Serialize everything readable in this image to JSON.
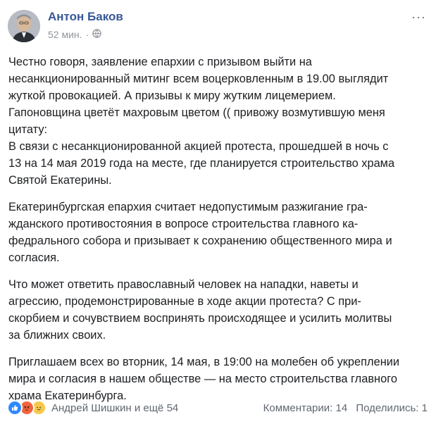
{
  "post": {
    "author": "Антон Баков",
    "time": "52 мин.",
    "dot": "·",
    "more": "···",
    "paragraphs": [
      [
        "Честно говоря, заявление епархии с призывом выйти на",
        "несанкционированный митинг всем воцерковленным в 19.00 выглядит",
        "жуткой провокацией. А призывы к миру жутким лицемерием.",
        "Гапоновщина цветёт махровым цветом (( привожу возмутившую меня",
        "цитату:",
        "В связи с несанкционированной акцией протеста, прошедшей в ночь с",
        "13 на 14 мая 2019 года на месте, где планируется строительство храма",
        "Святой Екатерины."
      ],
      [
        "Екатеринбургская епархия считает недопустимым разжигание гра-",
        "жданского противостояния в вопросе строительства главного ка-",
        "федрального собора и призывает к сохранению общественного мира и",
        "согласия."
      ],
      [
        "Что может ответить православный человек на нападки, наветы и",
        "агрессию, продемонстрированные в ходе акции протеста? С при-",
        "скорбием и сочувствием воспринять происходящее и усилить молитвы",
        "за ближних своих."
      ],
      [
        "Приглашаем всех во вторник, 14 мая, в 19:00 на молебен об укреплении",
        "мира и согласия в нашем обществе — на место строительства главного",
        "храма Екатеринбурга."
      ]
    ]
  },
  "footer": {
    "reactors": "Андрей Шишкин и ещё 54",
    "comments": "Комментарии: 14",
    "shares": "Поделились: 1"
  },
  "icons": {
    "privacy": "globe-icon",
    "reactions": [
      "like-icon",
      "angry-icon",
      "sad-icon"
    ]
  },
  "colors": {
    "author": "#385898",
    "meta": "#90949c",
    "like": "#2e89ff",
    "angry": "#f0643f",
    "sad": "#f7c84b"
  }
}
